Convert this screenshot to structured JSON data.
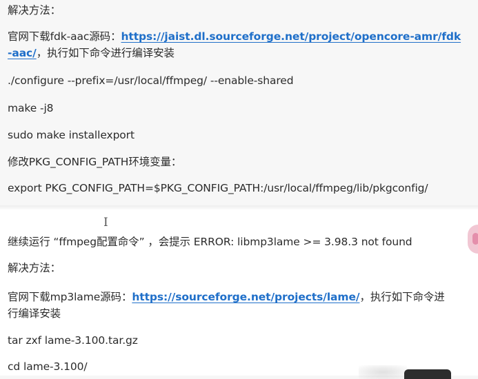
{
  "section1": {
    "solution_heading": "解决方法：",
    "download_prefix": "官网下载fdk-aac源码：",
    "download_link_line1": "https://jaist.dl.sourceforge.net/project/opencore-amr/fdk",
    "download_link_line2": "-aac/",
    "download_suffix": "，执行如下命令进行编译安装",
    "cmd_configure": "./configure --prefix=/usr/local/ffmpeg/ --enable-shared",
    "cmd_make": "make -j8",
    "cmd_install": "sudo make installexport",
    "env_heading": "修改PKG_CONFIG_PATH环境变量：",
    "cmd_export": "export PKG_CONFIG_PATH=$PKG_CONFIG_PATH:/usr/local/ffmpeg/lib/pkgconfig/"
  },
  "cursor_glyph": "I",
  "section2": {
    "error_line": "继续运行 “ffmpeg配置命令” ，会提示 ERROR: libmp3lame >= 3.98.3 not found",
    "solution_heading": "解决方法：",
    "download_prefix": "官网下载mp3lame源码：",
    "download_link": "https://sourceforge.net/projects/lame/",
    "download_suffix_line1": "，执行如下命令进",
    "download_suffix_line2": "行编译安装",
    "cmd_tar": "tar zxf lame-3.100.tar.gz",
    "cmd_cd": "cd lame-3.100/"
  },
  "colors": {
    "link": "#1f6fc9",
    "text": "#2b2b2b",
    "accent_tab": "#f1c7d3"
  }
}
